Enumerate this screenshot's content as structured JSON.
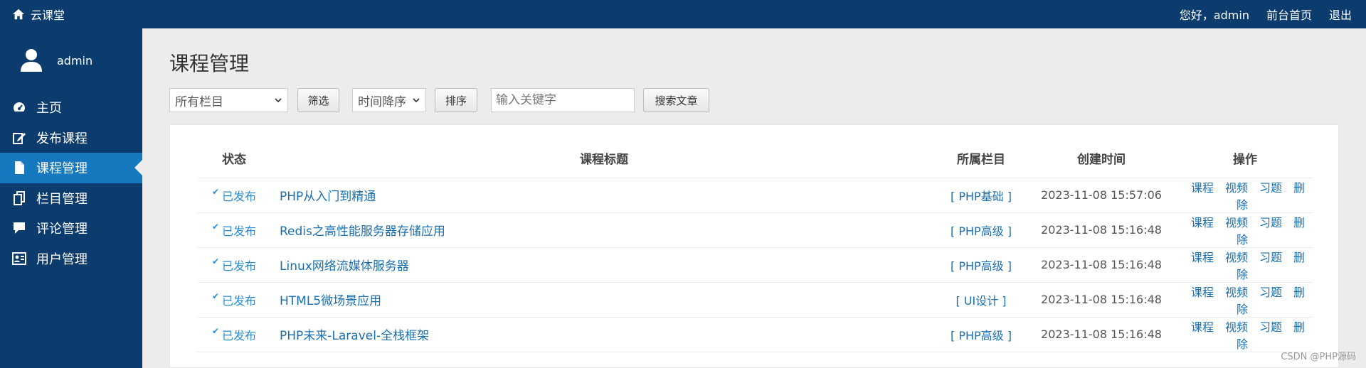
{
  "header": {
    "brand": "云课堂",
    "greeting": "您好，admin",
    "home_link": "前台首页",
    "logout": "退出"
  },
  "sidebar": {
    "username": "admin",
    "items": [
      {
        "label": "主页",
        "icon": "dashboard-icon"
      },
      {
        "label": "发布课程",
        "icon": "edit-icon"
      },
      {
        "label": "课程管理",
        "icon": "document-icon",
        "active": true
      },
      {
        "label": "栏目管理",
        "icon": "copy-icon"
      },
      {
        "label": "评论管理",
        "icon": "comment-icon"
      },
      {
        "label": "用户管理",
        "icon": "user-card-icon"
      }
    ]
  },
  "main": {
    "title": "课程管理",
    "filters": {
      "category_select": "所有栏目",
      "filter_button": "筛选",
      "sort_select": "时间降序",
      "sort_button": "排序",
      "search_placeholder": "输入关键字",
      "search_button": "搜索文章"
    },
    "table": {
      "headers": [
        "状态",
        "课程标题",
        "所属栏目",
        "创建时间",
        "操作"
      ],
      "rows": [
        {
          "status": "已发布",
          "title": "PHP从入门到精通",
          "category": "[ PHP基础 ]",
          "time": "2023-11-08 15:57:06"
        },
        {
          "status": "已发布",
          "title": "Redis之高性能服务器存储应用",
          "category": "[ PHP高级 ]",
          "time": "2023-11-08 15:16:48"
        },
        {
          "status": "已发布",
          "title": "Linux网络流媒体服务器",
          "category": "[ PHP高级 ]",
          "time": "2023-11-08 15:16:48"
        },
        {
          "status": "已发布",
          "title": "HTML5微场景应用",
          "category": "[ UI设计 ]",
          "time": "2023-11-08 15:16:48"
        },
        {
          "status": "已发布",
          "title": "PHP未来-Laravel-全栈框架",
          "category": "[ PHP高级 ]",
          "time": "2023-11-08 15:16:48"
        }
      ],
      "actions": [
        "课程",
        "视频",
        "习题",
        "删除"
      ]
    }
  },
  "watermark": "CSDN @PHP源码"
}
